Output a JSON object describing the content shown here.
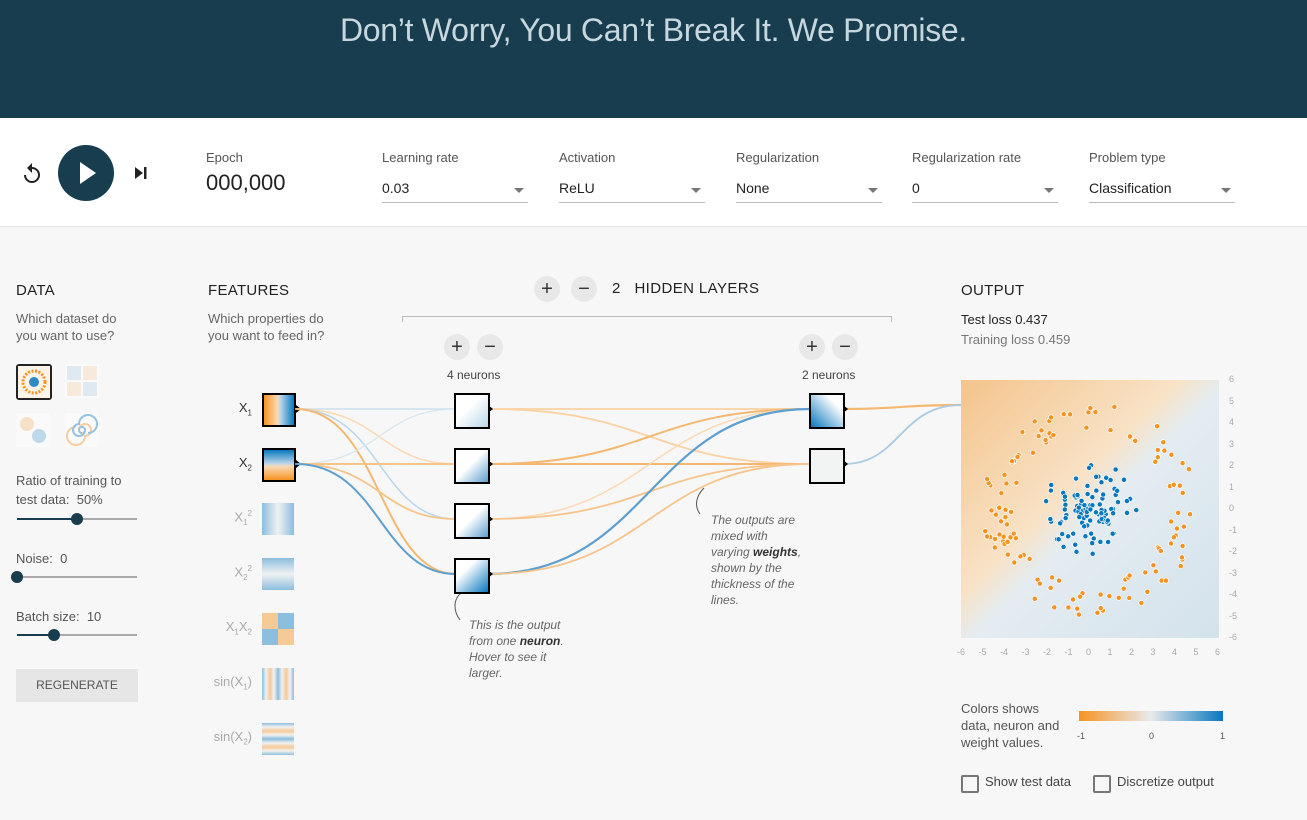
{
  "hero": {
    "title": "Don’t Worry, You Can’t Break It. We Promise."
  },
  "controls": {
    "epoch_label": "Epoch",
    "epoch_value": "000,000",
    "selects": [
      {
        "label": "Learning rate",
        "value": "0.03"
      },
      {
        "label": "Activation",
        "value": "ReLU"
      },
      {
        "label": "Regularization",
        "value": "None"
      },
      {
        "label": "Regularization rate",
        "value": "0"
      },
      {
        "label": "Problem type",
        "value": "Classification"
      }
    ]
  },
  "data_panel": {
    "heading": "DATA",
    "question": "Which dataset do you want to use?",
    "ratio_label": "Ratio of training to test data:",
    "ratio_value": "50%",
    "noise_label": "Noise:",
    "noise_value": "0",
    "batch_label": "Batch size:",
    "batch_value": "10",
    "regenerate": "REGENERATE",
    "ratio_fraction": 0.5,
    "noise_fraction": 0.0,
    "batch_fraction": 0.31
  },
  "features": {
    "heading": "FEATURES",
    "question": "Which properties do you want to feed in?"
  },
  "network": {
    "hidden_count": "2",
    "hidden_label": "HIDDEN LAYERS",
    "layers": [
      {
        "neurons": "4 neurons"
      },
      {
        "neurons": "2 neurons"
      }
    ],
    "note_neuron_1": "This is the output from one",
    "note_neuron_bold": "neuron",
    "note_neuron_2": ". Hover to see it larger.",
    "note_weights_1": "The outputs are mixed with varying",
    "note_weights_bold": "weights",
    "note_weights_2": ", shown by the thickness of the lines."
  },
  "output": {
    "heading": "OUTPUT",
    "test_loss_label": "Test loss",
    "test_loss": "0.437",
    "training_loss_label": "Training loss",
    "training_loss": "0.459",
    "y_ticks": [
      "6",
      "5",
      "4",
      "3",
      "2",
      "1",
      "0",
      "-1",
      "-2",
      "-3",
      "-4",
      "-5",
      "-6"
    ],
    "x_ticks": [
      "-6",
      "-5",
      "-4",
      "-3",
      "-2",
      "-1",
      "0",
      "1",
      "2",
      "3",
      "4",
      "5",
      "6"
    ],
    "legend_text": "Colors shows data, neuron and weight values.",
    "legend_ticks": [
      "-1",
      "0",
      "1"
    ],
    "show_test": "Show test data",
    "discretize": "Discretize output"
  },
  "colors": {
    "orange": "#f59322",
    "blue": "#0877bd",
    "navy": "#183d4e"
  }
}
